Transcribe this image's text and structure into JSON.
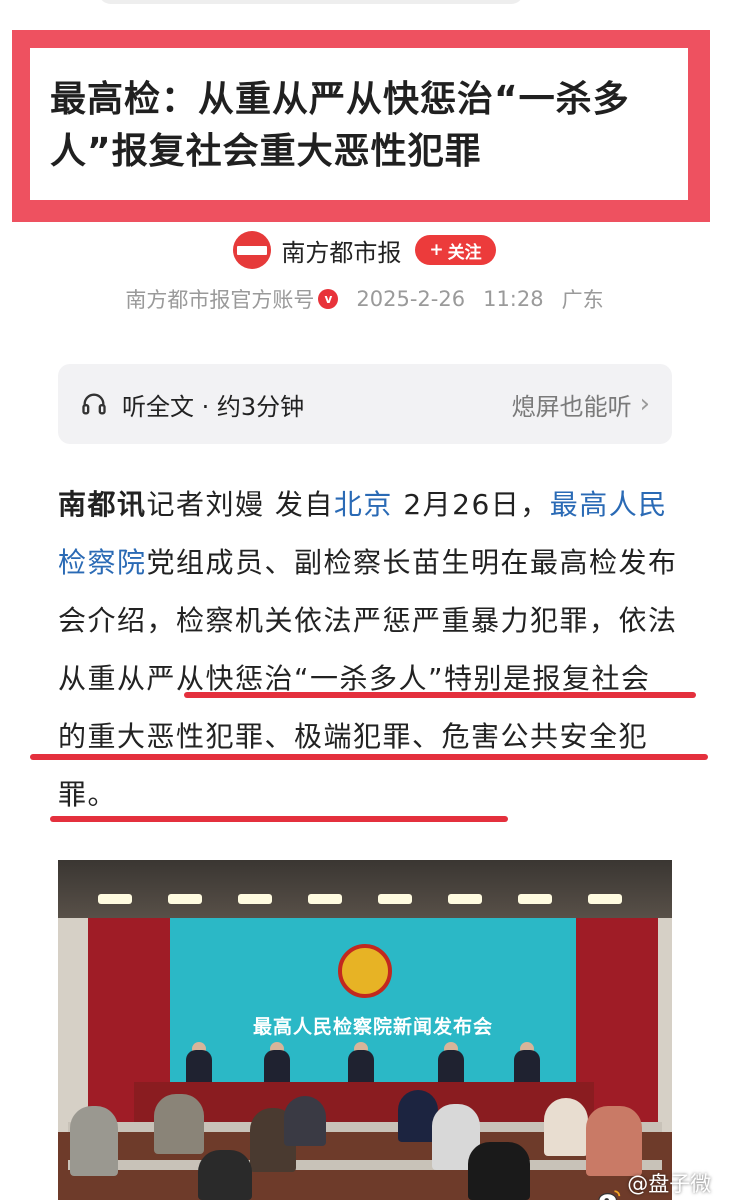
{
  "headline": {
    "line1": "最高检：从重从严从快惩治“一杀多",
    "line2": "人”报复社会重大恶性犯罪"
  },
  "author": {
    "name": "南方都市报",
    "follow_label": "关注",
    "follow_plus": "+",
    "account_label": "南方都市报官方账号",
    "verified_mark": "v",
    "date": "2025-2-26",
    "time": "11:28",
    "location": "广东"
  },
  "listen": {
    "label": "听全文 · 约3分钟",
    "right_label": "熄屏也能听",
    "chevron": "›"
  },
  "article": {
    "lead": "南都讯",
    "p1": "记者刘嫚 发自",
    "link_city": "北京",
    "p2": " 2月26日，",
    "link_org": "最高人民检察院",
    "p3": "党组成员、副检察长苗生明在最高检发布会介绍，检察机关依法严惩严重暴力犯罪，依法从重从严从快惩治“一杀多人”特别是报复社会的重大恶性犯罪、极端犯罪、危害公共安全犯罪。"
  },
  "photo": {
    "screen_text": "最高人民检察院新闻发布会"
  },
  "watermark": {
    "text": "@盘子微谈"
  },
  "colors": {
    "accent_red": "#ee5160",
    "link_blue": "#2a6ab5",
    "underline_red": "#e4303d"
  }
}
